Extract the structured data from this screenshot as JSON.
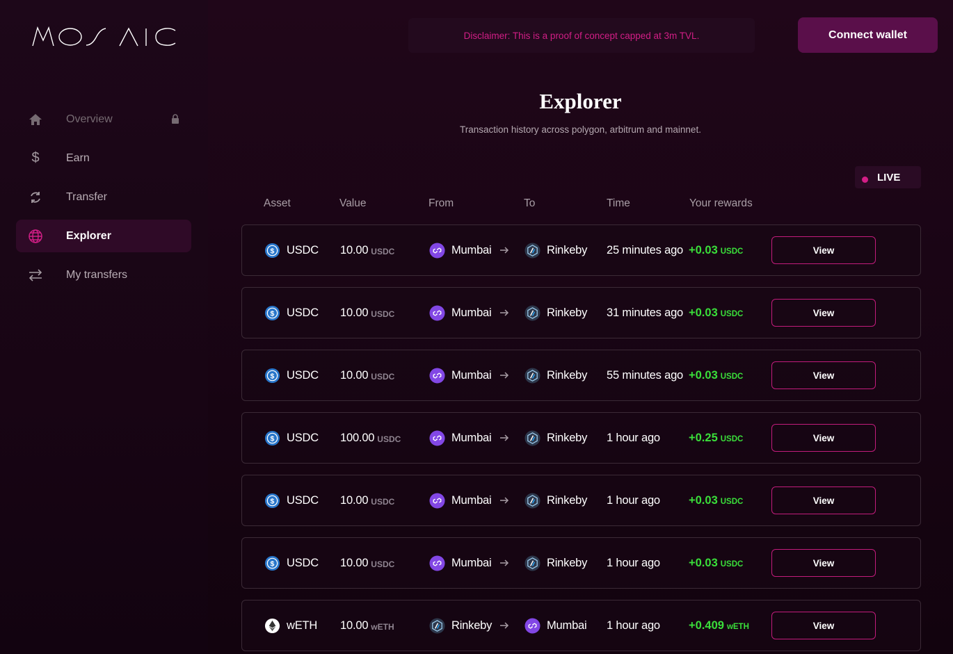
{
  "brand": {
    "logo_text": "MOSAIC"
  },
  "sidebar": {
    "items": [
      {
        "label": "Overview",
        "icon": "home-icon",
        "disabled": true
      },
      {
        "label": "Earn",
        "icon": "dollar-icon"
      },
      {
        "label": "Transfer",
        "icon": "refresh-icon"
      },
      {
        "label": "Explorer",
        "icon": "globe-icon",
        "active": true
      },
      {
        "label": "My transfers",
        "icon": "swap-arrows-icon"
      }
    ]
  },
  "header": {
    "disclaimer": "Disclaimer: This is a proof of concept capped at 3m TVL.",
    "connect_label": "Connect wallet"
  },
  "page": {
    "title": "Explorer",
    "subtitle": "Transaction history across polygon, arbitrum and mainnet.",
    "live_label": "LIVE"
  },
  "table": {
    "headers": {
      "asset": "Asset",
      "value": "Value",
      "from": "From",
      "to": "To",
      "time": "Time",
      "rewards": "Your rewards"
    },
    "view_label": "View",
    "rows": [
      {
        "asset": "USDC",
        "value": "10.00",
        "value_unit": "USDC",
        "from": "Mumbai",
        "to": "Rinkeby",
        "time": "25 minutes ago",
        "reward": "+0.03",
        "reward_unit": "USDC"
      },
      {
        "asset": "USDC",
        "value": "10.00",
        "value_unit": "USDC",
        "from": "Mumbai",
        "to": "Rinkeby",
        "time": "31 minutes ago",
        "reward": "+0.03",
        "reward_unit": "USDC"
      },
      {
        "asset": "USDC",
        "value": "10.00",
        "value_unit": "USDC",
        "from": "Mumbai",
        "to": "Rinkeby",
        "time": "55 minutes ago",
        "reward": "+0.03",
        "reward_unit": "USDC"
      },
      {
        "asset": "USDC",
        "value": "100.00",
        "value_unit": "USDC",
        "from": "Mumbai",
        "to": "Rinkeby",
        "time": "1 hour ago",
        "reward": "+0.25",
        "reward_unit": "USDC"
      },
      {
        "asset": "USDC",
        "value": "10.00",
        "value_unit": "USDC",
        "from": "Mumbai",
        "to": "Rinkeby",
        "time": "1 hour ago",
        "reward": "+0.03",
        "reward_unit": "USDC"
      },
      {
        "asset": "USDC",
        "value": "10.00",
        "value_unit": "USDC",
        "from": "Mumbai",
        "to": "Rinkeby",
        "time": "1 hour ago",
        "reward": "+0.03",
        "reward_unit": "USDC"
      },
      {
        "asset": "wETH",
        "value": "10.00",
        "value_unit": "wETH",
        "from": "Rinkeby",
        "to": "Mumbai",
        "time": "1 hour ago",
        "reward": "+0.409",
        "reward_unit": "wETH"
      }
    ]
  },
  "colors": {
    "accent": "#d21e86",
    "reward": "#3adf3a",
    "button": "#5a0f4a"
  }
}
